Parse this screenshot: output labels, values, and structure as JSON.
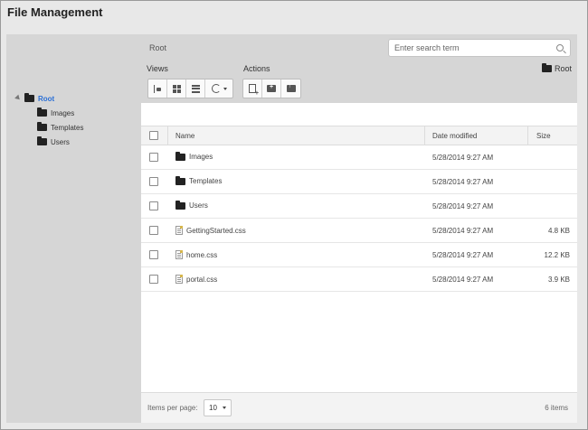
{
  "app": {
    "title": "File Management"
  },
  "tree": {
    "root": "Root",
    "children": [
      "Images",
      "Templates",
      "Users"
    ]
  },
  "toolbar": {
    "breadcrumb": "Root",
    "search_placeholder": "Enter search term",
    "views_label": "Views",
    "actions_label": "Actions",
    "current_folder": "Root"
  },
  "grid": {
    "headers": {
      "name": "Name",
      "date": "Date modified",
      "size": "Size"
    },
    "rows": [
      {
        "name": "Images",
        "type": "folder",
        "date": "5/28/2014 9:27 AM",
        "size": ""
      },
      {
        "name": "Templates",
        "type": "folder",
        "date": "5/28/2014 9:27 AM",
        "size": ""
      },
      {
        "name": "Users",
        "type": "folder",
        "date": "5/28/2014 9:27 AM",
        "size": ""
      },
      {
        "name": "GettingStarted.css",
        "type": "file",
        "date": "5/28/2014 9:27 AM",
        "size": "4.8 KB"
      },
      {
        "name": "home.css",
        "type": "file",
        "date": "5/28/2014 9:27 AM",
        "size": "12.2 KB"
      },
      {
        "name": "portal.css",
        "type": "file",
        "date": "5/28/2014 9:27 AM",
        "size": "3.9 KB"
      }
    ]
  },
  "footer": {
    "items_per_page_label": "Items per page:",
    "page_size": "10",
    "item_count": "6 items"
  },
  "icons": {
    "folder": "folder-icon",
    "file": "file-icon",
    "search": "search-icon",
    "tree_view": "tree-view-icon",
    "grid_view": "grid-view-icon",
    "list_view": "list-view-icon",
    "refresh": "refresh-icon",
    "new_file": "new-file-icon",
    "new_folder": "new-folder-icon",
    "upload": "upload-icon"
  },
  "colors": {
    "accent": "#2a6fd6",
    "panel_bg": "#d6d6d6",
    "window_bg": "#e8e8e8"
  }
}
